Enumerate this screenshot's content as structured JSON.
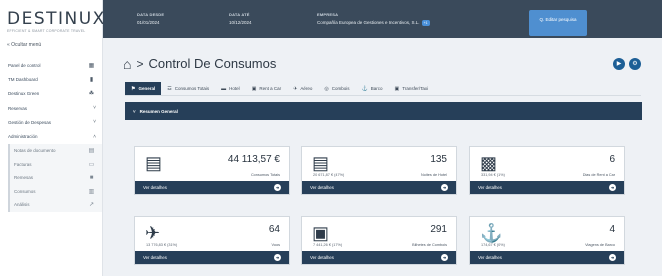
{
  "logo": {
    "name": "DESTINUX",
    "tagline": "EFFICIENT & SMART CORPORATE TRAVEL"
  },
  "sidebar": {
    "hide_menu": "« Ocultar menú",
    "items": [
      {
        "label": "Panel de control",
        "icon": "dashboard-icon",
        "glyph": "▦"
      },
      {
        "label": "TM Dashboard",
        "icon": "briefcase-icon",
        "glyph": "▮"
      },
      {
        "label": "Destinux Green",
        "icon": "leaf-icon",
        "glyph": "☘"
      },
      {
        "label": "Reservas",
        "icon": "chevron-down-icon",
        "glyph": "˅",
        "expandable": true
      },
      {
        "label": "Gestión de Despesas",
        "icon": "chevron-down-icon",
        "glyph": "˅",
        "expandable": true
      },
      {
        "label": "Administración",
        "icon": "chevron-up-icon",
        "glyph": "˄",
        "expandable": true
      }
    ],
    "sub_items": [
      {
        "label": "Notas de documento",
        "icon": "document-icon",
        "glyph": "▤"
      },
      {
        "label": "Facturas",
        "icon": "invoice-icon",
        "glyph": "▭"
      },
      {
        "label": "Remesas",
        "icon": "stack-icon",
        "glyph": "■"
      },
      {
        "label": "Consumos",
        "icon": "chart-icon",
        "glyph": "▥"
      },
      {
        "label": "Análisis",
        "icon": "analytics-icon",
        "glyph": "↗"
      }
    ]
  },
  "header": {
    "date_from_label": "DATA DESDE",
    "date_from": "01/01/2024",
    "date_to_label": "DATA ATÉ",
    "date_to": "10/12/2024",
    "company_label": "EMPRESA",
    "company": "Compañía Europea de Gestiones e Incentivos, S.L.",
    "company_badge": "+1",
    "edit_button": "Q. Editar pesquisa"
  },
  "page": {
    "title": "Control De Consumos",
    "breadcrumb_sep": ">",
    "tabs": [
      {
        "label": "General",
        "glyph": "⚑",
        "active": true
      },
      {
        "label": "Consumos Totais",
        "glyph": "☲"
      },
      {
        "label": "Hotel",
        "glyph": "▬"
      },
      {
        "label": "Rent a Car",
        "glyph": "▣"
      },
      {
        "label": "Aéreo",
        "glyph": "✈"
      },
      {
        "label": "Combois",
        "glyph": "◎"
      },
      {
        "label": "Barco",
        "glyph": "⚓"
      },
      {
        "label": "Transfer/Taxi",
        "glyph": "▣"
      }
    ],
    "section_title": "Resumen General"
  },
  "cards": [
    {
      "value": "44 113,57 €",
      "label": "Consumos Totais",
      "pct": "",
      "footer": "Ver detalhes",
      "icon": "cart-icon",
      "glyph": "🛒"
    },
    {
      "value": "135",
      "label": "Noites de Hotel",
      "pct": "20 671,87 € (47%)",
      "footer": "Ver detalhes",
      "icon": "bed-icon",
      "glyph": "⨿"
    },
    {
      "value": "6",
      "label": "Dias de Rent a Car",
      "pct": "331,94 € (1%)",
      "footer": "Ver detalhes",
      "icon": "car-icon",
      "glyph": "❖"
    },
    {
      "value": "64",
      "label": "Voos",
      "pct": "13 776,83 € (31%)",
      "footer": "Ver detalhes",
      "icon": "airplane-icon",
      "glyph": "✈"
    },
    {
      "value": "291",
      "label": "Bilhetes de Combois",
      "pct": "7 441,26 € (17%)",
      "footer": "Ver detalhes",
      "icon": "train-icon",
      "glyph": "▣"
    },
    {
      "value": "4",
      "label": "Viagens de Barco",
      "pct": "174,67 € (0%)",
      "footer": "Ver detalhes",
      "icon": "ship-icon",
      "glyph": "⚓"
    }
  ]
}
